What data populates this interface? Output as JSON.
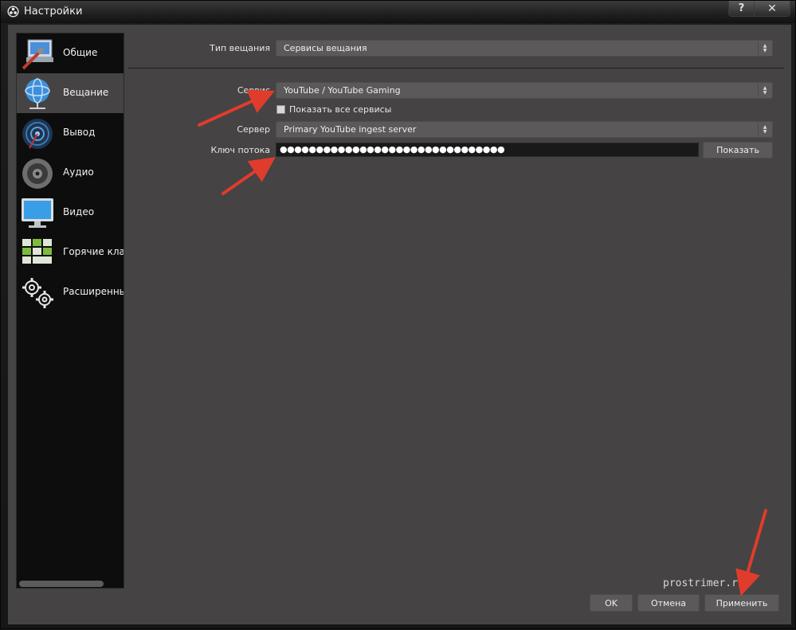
{
  "window": {
    "title": "Настройки",
    "help_label": "?",
    "close_label": "✕"
  },
  "sidebar": {
    "items": [
      {
        "label": "Общие",
        "icon": "general-settings-icon"
      },
      {
        "label": "Вещание",
        "icon": "broadcast-globe-icon"
      },
      {
        "label": "Вывод",
        "icon": "output-signal-icon"
      },
      {
        "label": "Аудио",
        "icon": "speaker-icon"
      },
      {
        "label": "Видео",
        "icon": "monitor-icon"
      },
      {
        "label": "Горячие клави",
        "icon": "keyboard-icon"
      },
      {
        "label": "Расширенные",
        "icon": "gears-icon"
      }
    ],
    "active_index": 1
  },
  "form": {
    "broadcast_type_label": "Тип вещания",
    "broadcast_type_value": "Сервисы вещания",
    "service_label": "Сервис",
    "service_value": "YouTube / YouTube Gaming",
    "show_all_label": "Показать все сервисы",
    "show_all_checked": false,
    "server_label": "Сервер",
    "server_value": "Primary YouTube ingest server",
    "stream_key_label": "Ключ потока",
    "stream_key_masked": "●●●●●●●●●●●●●●●●●●●●●●●●●●●●●●●",
    "show_button": "Показать"
  },
  "footer": {
    "watermark": "prostrimer.ru",
    "ok_label": "OK",
    "cancel_label": "Отмена",
    "apply_label": "Применить"
  },
  "colors": {
    "panel": "#454344",
    "sidebar": "#0d0d0d",
    "annotation_arrow": "#e03c2c"
  }
}
